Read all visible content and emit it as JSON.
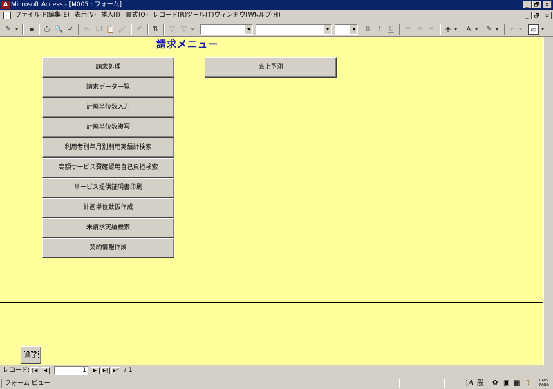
{
  "window": {
    "title": "Microsoft Access - [M005 : フォーム]",
    "app_icon": "access-icon",
    "controls": [
      "_",
      "🗗",
      "×"
    ]
  },
  "menu": {
    "items": [
      "ファイル(F)",
      "編集(E)",
      "表示(V)",
      "挿入(I)",
      "書式(O)",
      "レコード(R)",
      "ツール(T)",
      "ウィンドウ(W)",
      "ヘルプ(H)"
    ],
    "doc_controls": [
      "_",
      "🗗",
      "×"
    ]
  },
  "toolbar": {
    "font_style_buttons": [
      "B",
      "I",
      "U"
    ]
  },
  "form": {
    "title": "請求メニュー",
    "left_buttons": [
      "請求処理",
      "請求データ一覧",
      "計画単位数入力",
      "計画単位数複写",
      "利用者別年月別利用実績計検索",
      "高額サービス費確認用自己負担検索",
      "サービス提供証明書印刷",
      "計画単位数仮作成",
      "未請求実績検索",
      "契約情報作成"
    ],
    "right_buttons": [
      "売上予測"
    ],
    "end_button": "終了"
  },
  "record_nav": {
    "label": "レコード:",
    "current": "1",
    "total": "/ 1"
  },
  "status": {
    "text": "フォーム ビュー",
    "ime_mode": "般",
    "caps": "CAPS",
    "kana": "KANA"
  },
  "colors": {
    "form_bg": "#ffff9c",
    "title_color": "#1a1ab0",
    "titlebar_bg": "#0a246a"
  }
}
